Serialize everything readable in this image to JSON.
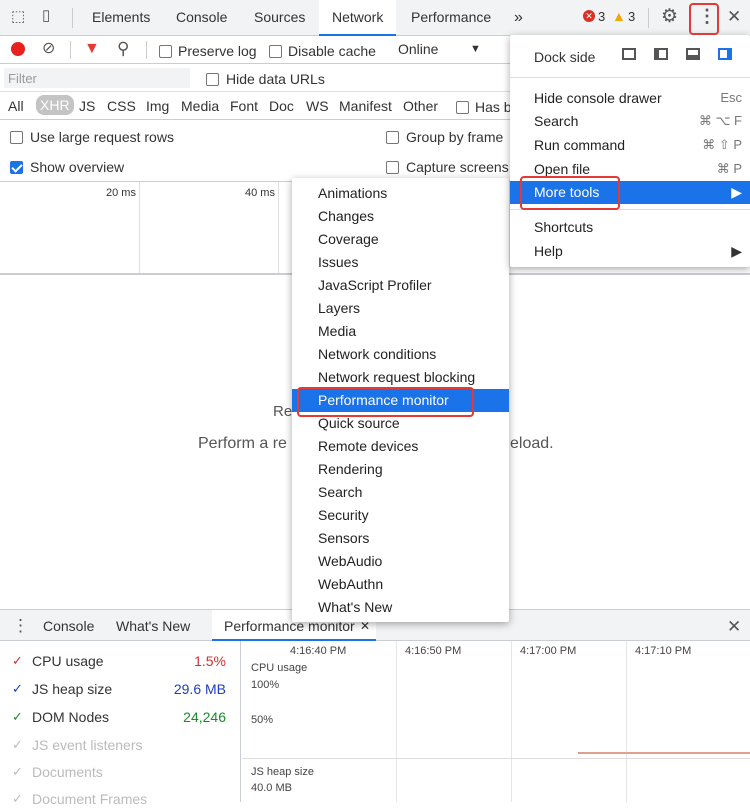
{
  "toolbar": {
    "tabs": [
      "Elements",
      "Console",
      "Sources",
      "Network",
      "Performance"
    ],
    "more": "»",
    "errors": "3",
    "warnings": "3"
  },
  "net": {
    "preserve": "Preserve log",
    "disable": "Disable cache",
    "throttle": "Online",
    "filter_ph": "Filter",
    "hide": "Hide data URLs",
    "types": [
      "All",
      "XHR",
      "JS",
      "CSS",
      "Img",
      "Media",
      "Font",
      "Doc",
      "WS",
      "Manifest",
      "Other"
    ],
    "hasb": "Has b",
    "large": "Use large request rows",
    "overview": "Show overview",
    "group": "Group by frame",
    "capture": "Capture screens",
    "t20": "20 ms",
    "t40": "40 ms",
    "empty1": "Re",
    "empty1b": "",
    "empty2a": "Perform a re",
    "empty2b": "eload."
  },
  "main_menu": {
    "dock": "Dock side",
    "hide": "Hide console drawer",
    "hide_sc": "Esc",
    "search": "Search",
    "search_sc": "⌘ ⌥ F",
    "run": "Run command",
    "run_sc": "⌘ ⇧ P",
    "open": "Open file",
    "open_sc": "⌘ P",
    "more": "More tools",
    "shortcuts": "Shortcuts",
    "help": "Help"
  },
  "tools": [
    "Animations",
    "Changes",
    "Coverage",
    "Issues",
    "JavaScript Profiler",
    "Layers",
    "Media",
    "Network conditions",
    "Network request blocking",
    "Performance monitor",
    "Quick source",
    "Remote devices",
    "Rendering",
    "Search",
    "Security",
    "Sensors",
    "WebAudio",
    "WebAuthn",
    "What's New"
  ],
  "drawer": {
    "tabs": [
      "Console",
      "What's New",
      "Performance monitor"
    ],
    "metrics": [
      {
        "label": "CPU usage",
        "value": "1.5%",
        "color": "#d32f2f"
      },
      {
        "label": "JS heap size",
        "value": "29.6 MB",
        "color": "#1a3fc9"
      },
      {
        "label": "DOM Nodes",
        "value": "24,246",
        "color": "#1b8a2a"
      },
      {
        "label": "JS event listeners",
        "value": "",
        "color": "#bbb"
      },
      {
        "label": "Documents",
        "value": "",
        "color": "#bbb"
      },
      {
        "label": "Document Frames",
        "value": "",
        "color": "#bbb"
      }
    ],
    "times": [
      "4:16:40 PM",
      "4:16:50 PM",
      "4:17:00 PM",
      "4:17:10 PM"
    ],
    "cpu": "CPU usage",
    "p100": "100%",
    "p50": "50%",
    "heap": "JS heap size",
    "heapv": "40.0 MB"
  }
}
